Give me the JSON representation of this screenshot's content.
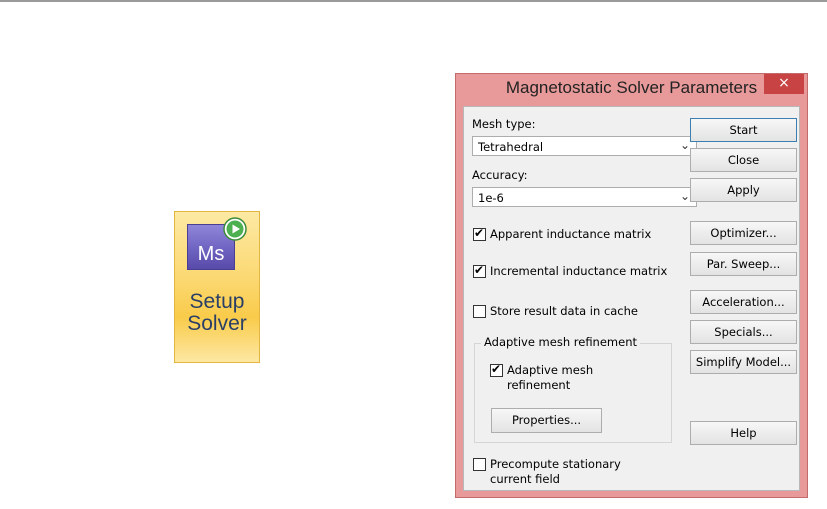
{
  "ribbon": {
    "icon_text": "Ms",
    "label_line1": "Setup",
    "label_line2": "Solver",
    "icon": "ms-solver-icon",
    "badge_icon": "play-icon"
  },
  "dialog": {
    "title": "Magnetostatic Solver Parameters",
    "close_glyph": "×",
    "mesh_type_label": "Mesh type:",
    "mesh_type_value": "Tetrahedral",
    "accuracy_label": "Accuracy:",
    "accuracy_value": "1e-6",
    "checks": {
      "apparent": "Apparent inductance matrix",
      "incremental": "Incremental inductance matrix",
      "store_cache": "Store result data in cache",
      "adaptive_mesh_line1": "Adaptive mesh",
      "adaptive_mesh_line2": "refinement",
      "precompute_line1": "Precompute stationary",
      "precompute_line2": "current field"
    },
    "group_title": "Adaptive mesh refinement",
    "properties_button": "Properties...",
    "buttons": {
      "start": "Start",
      "close": "Close",
      "apply": "Apply",
      "optimizer": "Optimizer...",
      "par_sweep": "Par. Sweep...",
      "acceleration": "Acceleration...",
      "specials": "Specials...",
      "simplify_model": "Simplify Model...",
      "help": "Help"
    },
    "colors": {
      "frame": "#e89a9a",
      "close_button": "#c84444",
      "ribbon_highlight": "#f9cb4a"
    }
  }
}
